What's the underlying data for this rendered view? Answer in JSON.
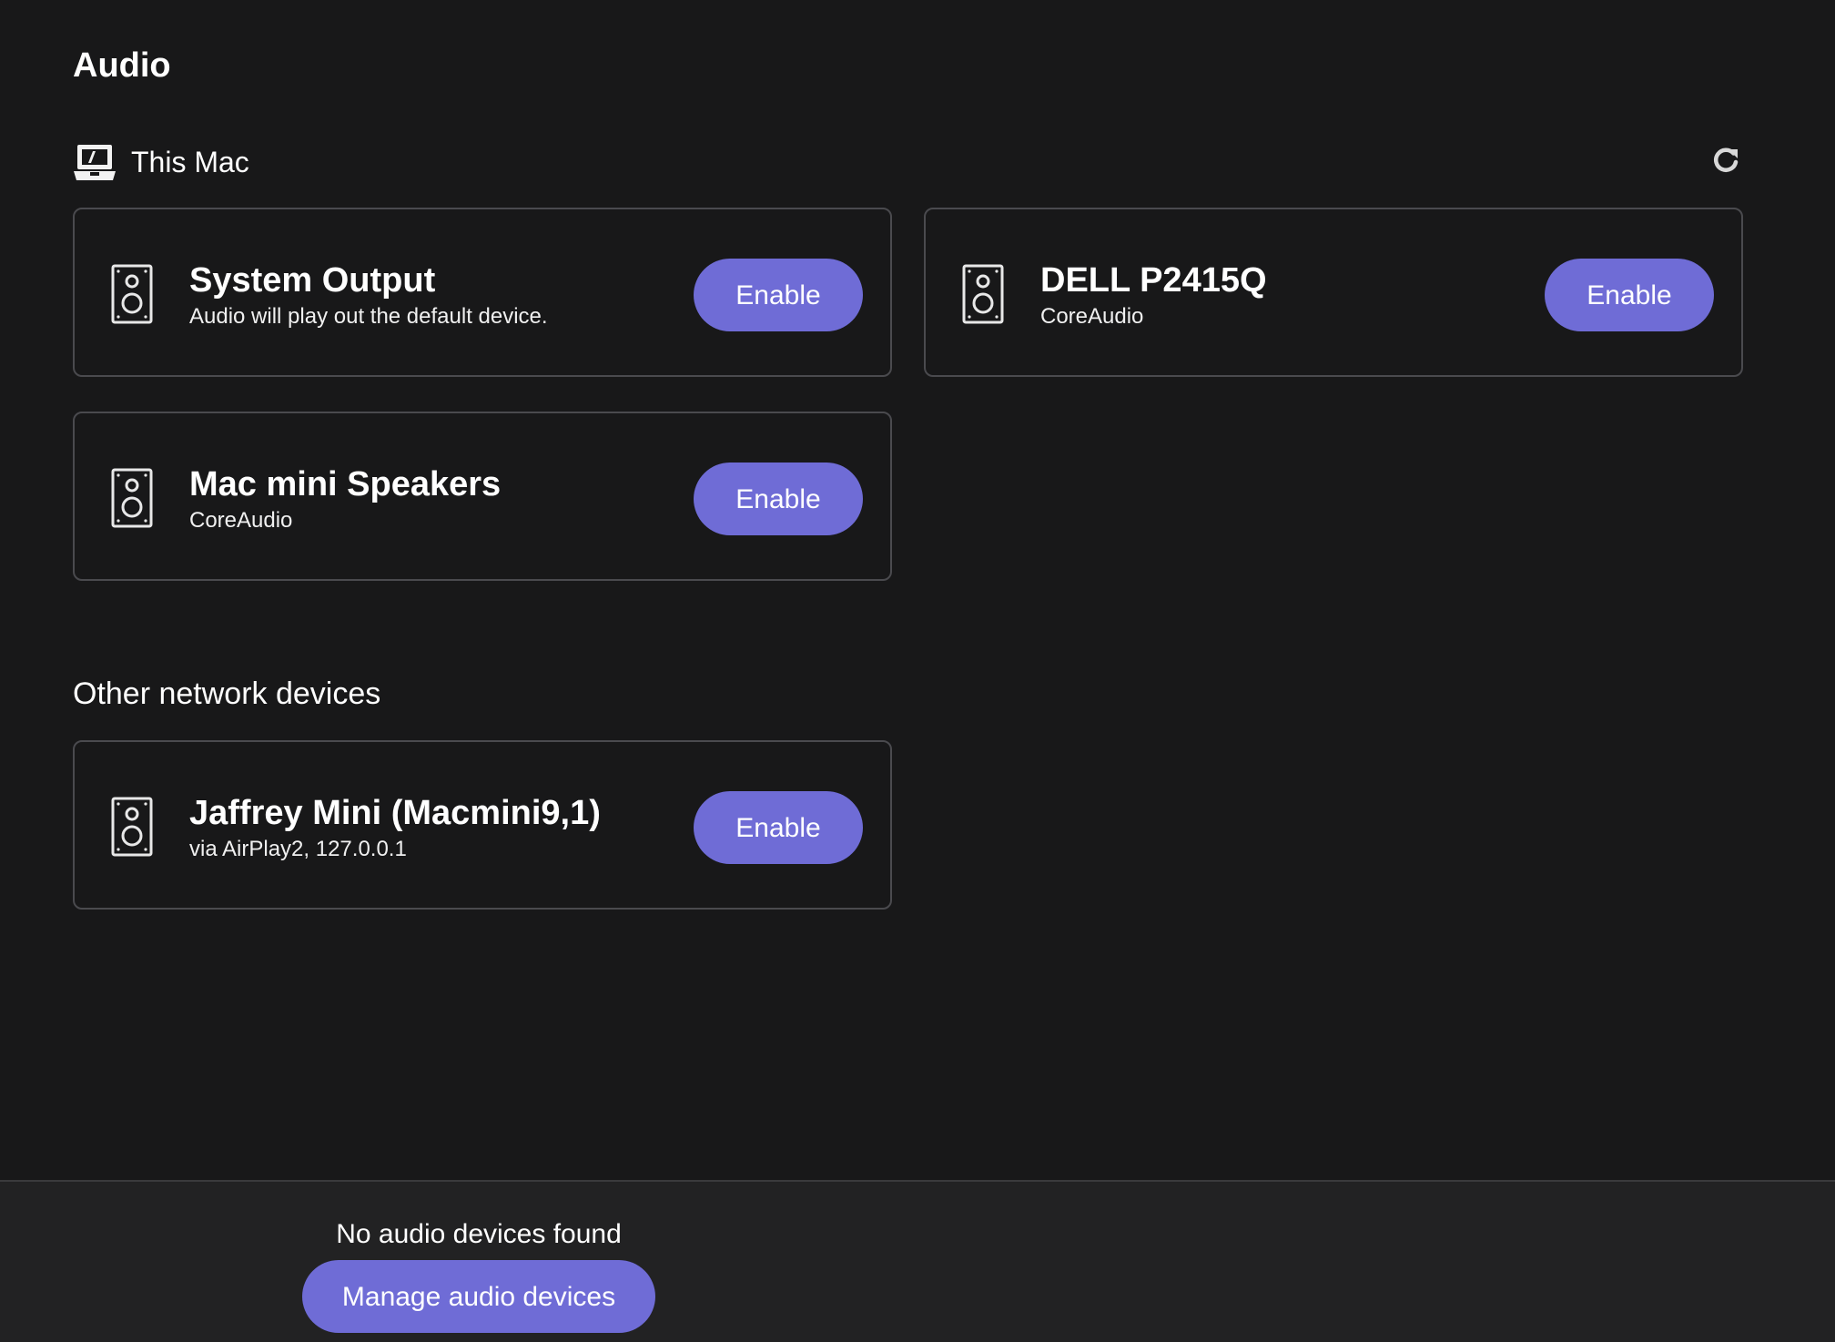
{
  "page": {
    "title": "Audio"
  },
  "this_mac": {
    "label": "This Mac",
    "icon": "laptop-icon",
    "refresh_icon": "refresh-icon"
  },
  "devices": [
    {
      "name": "System Output",
      "subtitle": "Audio will play out the default device.",
      "button": "Enable",
      "icon": "speaker-icon"
    },
    {
      "name": "DELL P2415Q",
      "subtitle": "CoreAudio",
      "button": "Enable",
      "icon": "speaker-icon"
    },
    {
      "name": "Mac mini Speakers",
      "subtitle": "CoreAudio",
      "button": "Enable",
      "icon": "speaker-icon"
    }
  ],
  "other_network": {
    "title": "Other network devices",
    "devices": [
      {
        "name": "Jaffrey Mini (Macmini9,1)",
        "subtitle": "via AirPlay2, 127.0.0.1",
        "button": "Enable",
        "icon": "speaker-icon"
      }
    ]
  },
  "footer": {
    "message": "No audio devices found",
    "button": "Manage audio devices"
  },
  "colors": {
    "background": "#181819",
    "accent": "#6f6cd6",
    "footer_background": "#222223",
    "card_border": "#4a4a4e"
  }
}
